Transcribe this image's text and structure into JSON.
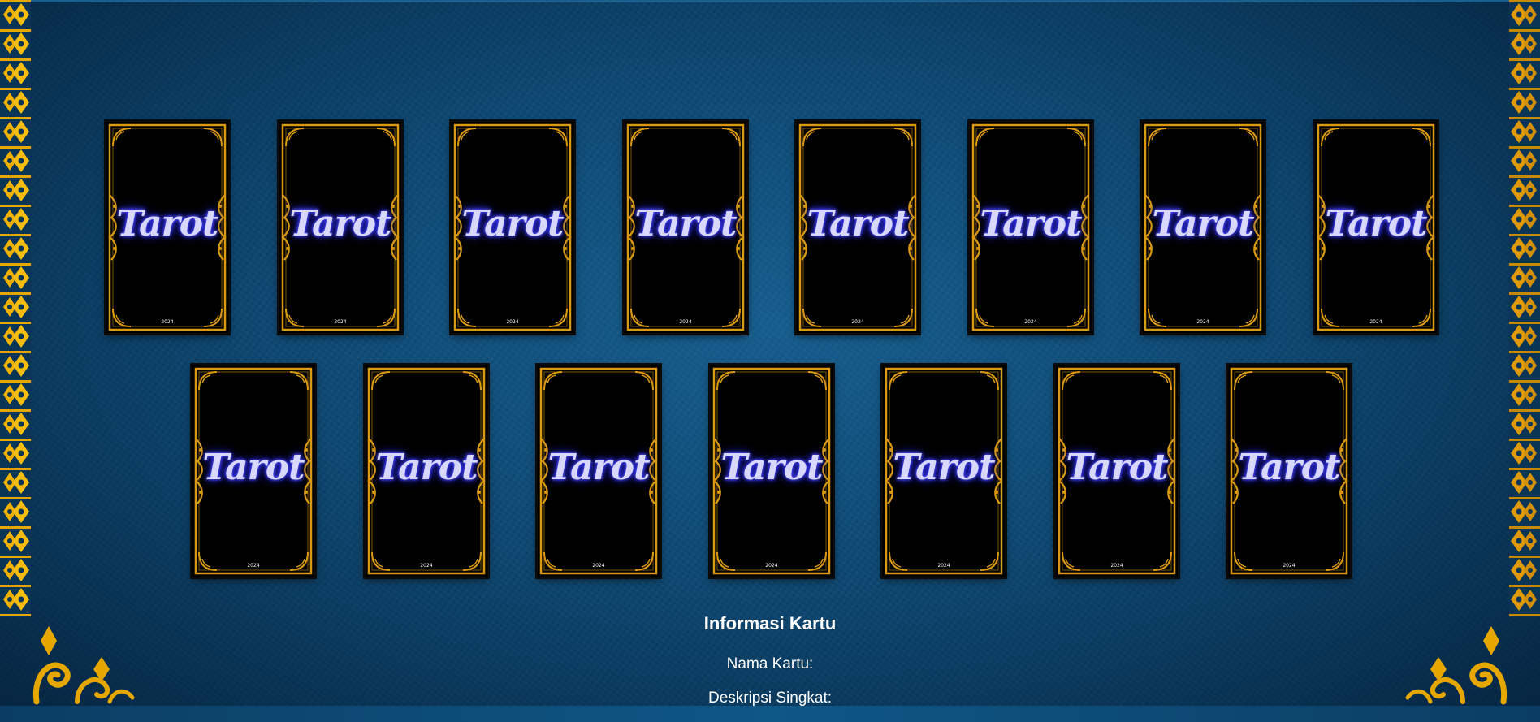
{
  "cards": {
    "title": "Tarot",
    "year": "2024",
    "row1_count": 8,
    "row2_count": 7
  },
  "info": {
    "heading": "Informasi Kartu",
    "name_label": "Nama Kartu:",
    "desc_label": "Deskripsi Singkat:"
  },
  "colors": {
    "background": "#0d4a75",
    "gold": "#d99a12",
    "card": "#000000",
    "title_glow": "#3a3aff",
    "title_text": "#d8d8ff"
  }
}
